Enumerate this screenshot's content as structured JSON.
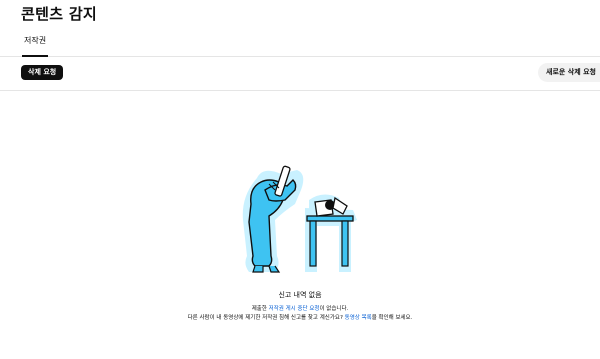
{
  "header": {
    "title": "콘텐츠 감지"
  },
  "tabs": [
    {
      "label": "저작권",
      "active": true
    }
  ],
  "toolbar": {
    "delete_request_label": "삭제 요청",
    "new_request_label": "새로운 삭제 요청"
  },
  "empty_state": {
    "illustration_icon": "microscope-person-illustration",
    "title": "신고 내역 없음",
    "line1_before": "제출한 ",
    "line1_link": "저작권 게시 중단 요청",
    "line1_after": "이 없습니다.",
    "line2_before": "다른 사람이 내 동영상에 제기한 저작권 침해 신고를 찾고 계신가요? ",
    "line2_link": "동영상 목록",
    "line2_after": "을 확인해 보세요."
  },
  "colors": {
    "accent_link": "#065fd4",
    "illustration_fill": "#3ec3f2",
    "primary_button": "#0f0f0f",
    "secondary_button": "#f2f2f2"
  }
}
